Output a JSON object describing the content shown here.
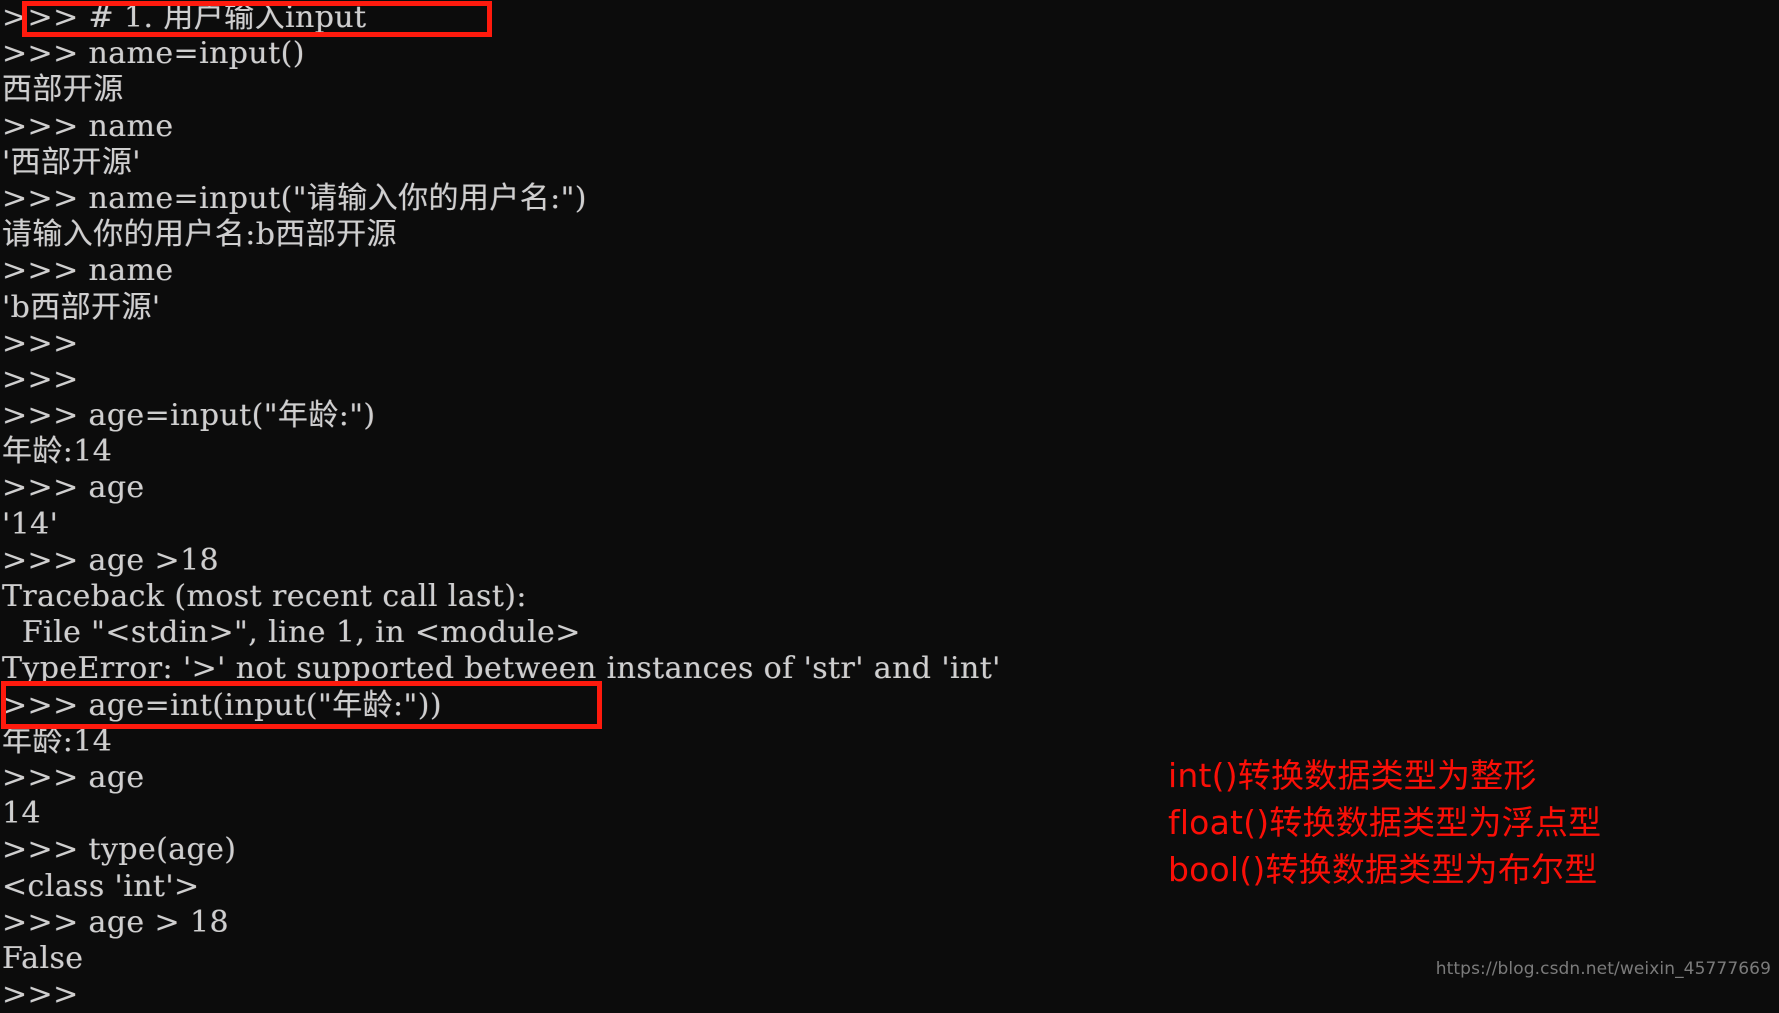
{
  "app": {
    "type": "python-interactive-shell",
    "background_color": "#0c0c0c",
    "text_color": "#cfcfcf",
    "accent_color": "#fa0f07"
  },
  "console": {
    "lines": [
      ">>> # 1. 用户输入input",
      ">>> name=input()",
      "西部开源",
      ">>> name",
      "'西部开源'",
      ">>> name=input(\"请输入你的用户名:\")",
      "请输入你的用户名:b西部开源",
      ">>> name",
      "'b西部开源'",
      ">>>",
      ">>>",
      ">>> age=input(\"年龄:\")",
      "年龄:14",
      ">>> age",
      "'14'",
      ">>> age >18",
      "Traceback (most recent call last):",
      "  File \"<stdin>\", line 1, in <module>",
      "TypeError: '>' not supported between instances of 'str' and 'int'",
      ">>> age=int(input(\"年龄:\"))",
      "年龄:14",
      ">>> age",
      "14",
      ">>> type(age)",
      "<class 'int'>",
      ">>> age > 18",
      "False",
      ">>>"
    ]
  },
  "annotations": {
    "boxes": [
      {
        "name": "input-comment-highlight",
        "target_line": ">>> # 1. 用户输入input",
        "color": "#ff1a0d"
      },
      {
        "name": "int-input-highlight",
        "target_line": ">>> age=int(input(\"年龄:\"))",
        "color": "#ff1a0d"
      }
    ],
    "notes": [
      "int()转换数据类型为整形",
      "float()转换数据类型为浮点型",
      "bool()转换数据类型为布尔型"
    ]
  },
  "watermark": {
    "text": "https://blog.csdn.net/weixin_45777669"
  }
}
